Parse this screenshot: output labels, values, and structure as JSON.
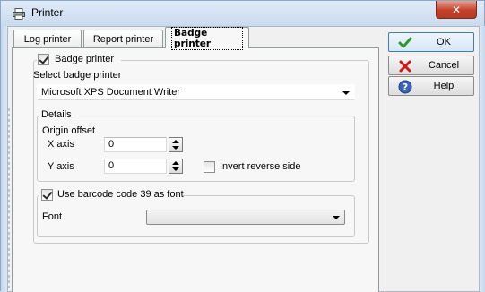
{
  "window": {
    "title": "Printer",
    "close_glyph": "✕"
  },
  "tabs": [
    {
      "label": "Log printer",
      "active": false
    },
    {
      "label": "Report printer",
      "active": false
    },
    {
      "label": "Badge printer",
      "active": true
    }
  ],
  "badge_group": {
    "checkbox_label": "Badge printer",
    "checked": true,
    "select_label": "Select badge printer",
    "selected_printer": "Microsoft XPS Document Writer"
  },
  "details": {
    "legend": "Details",
    "origin_offset_label": "Origin offset",
    "x_axis_label": "X axis",
    "x_axis_value": "0",
    "y_axis_label": "Y axis",
    "y_axis_value": "0",
    "invert_label": "Invert reverse side",
    "invert_checked": false
  },
  "barcode_group": {
    "checkbox_label": "Use barcode code 39 as font",
    "checked": true,
    "font_label": "Font",
    "font_value": ""
  },
  "buttons": {
    "ok": {
      "label": "OK",
      "icon": "check-icon"
    },
    "cancel": {
      "label": "Cancel",
      "icon": "cross-icon"
    },
    "help": {
      "label": "Help",
      "icon": "help-icon"
    }
  },
  "colors": {
    "check_green": "#2e9a2a",
    "cancel_red": "#d01818",
    "help_blue": "#3b64b8"
  }
}
